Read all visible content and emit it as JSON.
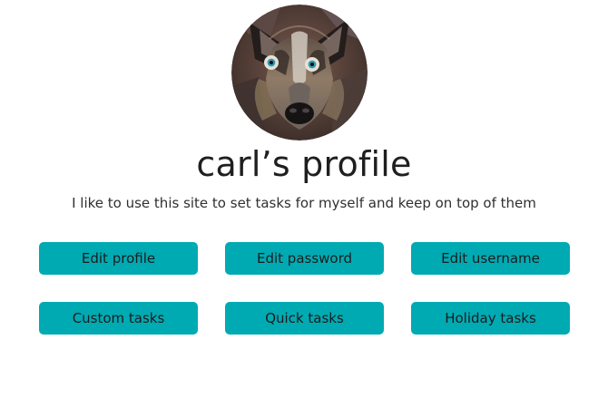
{
  "profile": {
    "title": "carl’s profile",
    "bio": "I like to use this site to set tasks for myself and keep on top of them",
    "avatar_icon": "dog-avatar-icon"
  },
  "actions": {
    "edit_profile": "Edit profile",
    "edit_password": "Edit password",
    "edit_username": "Edit username",
    "custom_tasks": "Custom tasks",
    "quick_tasks": "Quick tasks",
    "holiday_tasks": "Holiday tasks"
  },
  "colors": {
    "button_bg": "#00aab3",
    "title_text": "#1f1f1f",
    "page_bg": "#ffffff"
  }
}
